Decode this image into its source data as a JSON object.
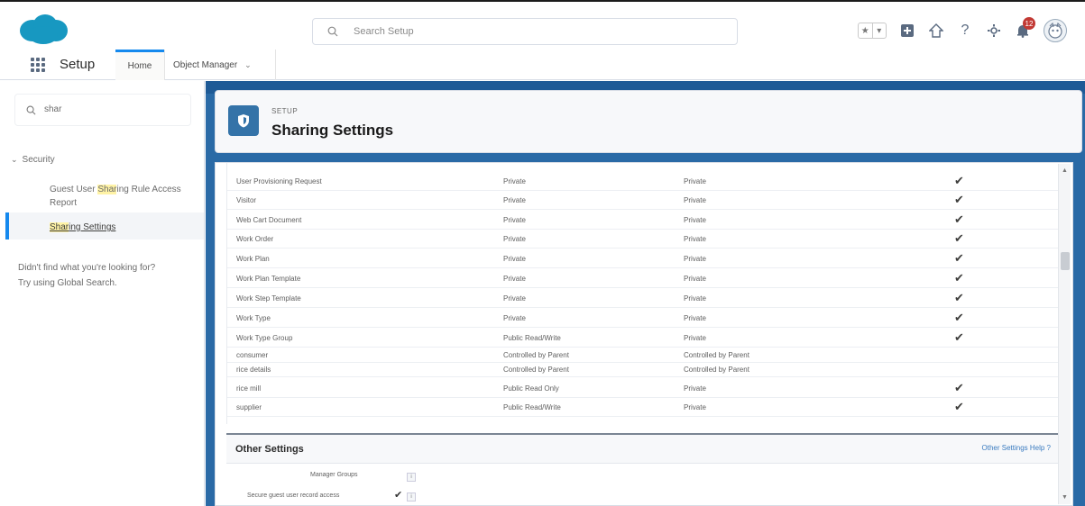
{
  "header": {
    "search_placeholder": "Search Setup",
    "fav_star": "★",
    "fav_caret": "▾",
    "notification_count": "12"
  },
  "nav": {
    "app_name": "Setup",
    "tabs": [
      {
        "label": "Home"
      },
      {
        "label": "Object Manager"
      }
    ]
  },
  "sidebar": {
    "quick_find_value": "shar",
    "tree_section": "Security",
    "items": [
      {
        "pre": "Guest User ",
        "hl": "Shar",
        "post": "ing Rule Access Report"
      },
      {
        "pre": "",
        "hl": "Shar",
        "post": "ing Settings"
      }
    ],
    "not_found_line1": "Didn't find what you're looking for?",
    "not_found_line2": "Try using Global Search."
  },
  "page_header": {
    "eyebrow": "SETUP",
    "title": "Sharing Settings"
  },
  "table": {
    "rows": [
      {
        "object": "User Provisioning Request",
        "default_internal": "Private",
        "default_external": "Private",
        "check": "✔"
      },
      {
        "object": "Visitor",
        "default_internal": "Private",
        "default_external": "Private",
        "check": "✔"
      },
      {
        "object": "Web Cart Document",
        "default_internal": "Private",
        "default_external": "Private",
        "check": "✔"
      },
      {
        "object": "Work Order",
        "default_internal": "Private",
        "default_external": "Private",
        "check": "✔"
      },
      {
        "object": "Work Plan",
        "default_internal": "Private",
        "default_external": "Private",
        "check": "✔"
      },
      {
        "object": "Work Plan Template",
        "default_internal": "Private",
        "default_external": "Private",
        "check": "✔"
      },
      {
        "object": "Work Step Template",
        "default_internal": "Private",
        "default_external": "Private",
        "check": "✔"
      },
      {
        "object": "Work Type",
        "default_internal": "Private",
        "default_external": "Private",
        "check": "✔"
      },
      {
        "object": "Work Type Group",
        "default_internal": "Public Read/Write",
        "default_external": "Private",
        "check": "✔"
      },
      {
        "object": "consumer",
        "default_internal": "Controlled by Parent",
        "default_external": "Controlled by Parent",
        "check": ""
      },
      {
        "object": "rice details",
        "default_internal": "Controlled by Parent",
        "default_external": "Controlled by Parent",
        "check": ""
      },
      {
        "object": "rice mill",
        "default_internal": "Public Read Only",
        "default_external": "Private",
        "check": "✔"
      },
      {
        "object": "supplier",
        "default_internal": "Public Read/Write",
        "default_external": "Private",
        "check": "✔"
      }
    ]
  },
  "other_settings": {
    "title": "Other Settings",
    "help": "Other Settings Help",
    "manager_groups_label": "Manager Groups",
    "secure_guest_label": "Secure guest user record access",
    "secure_guest_check": "✔"
  }
}
